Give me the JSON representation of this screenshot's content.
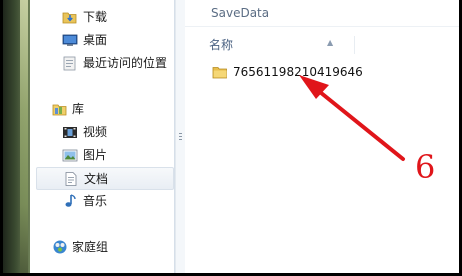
{
  "window": {
    "folder_title": "SaveData"
  },
  "sidebar": {
    "items": [
      {
        "label": "下载",
        "icon": "downloads-folder-icon"
      },
      {
        "label": "桌面",
        "icon": "desktop-icon"
      },
      {
        "label": "最近访问的位置",
        "icon": "recent-places-icon"
      },
      {
        "label": "库",
        "icon": "library-icon"
      },
      {
        "label": "视频",
        "icon": "videos-icon"
      },
      {
        "label": "图片",
        "icon": "pictures-icon"
      },
      {
        "label": "文档",
        "icon": "documents-icon"
      },
      {
        "label": "音乐",
        "icon": "music-icon"
      },
      {
        "label": "家庭组",
        "icon": "homegroup-icon"
      }
    ]
  },
  "content": {
    "column_name": "名称",
    "sort_glyph": "▲",
    "files": [
      {
        "name": "76561198210419646",
        "icon": "folder-icon"
      }
    ]
  },
  "annotation": {
    "number": "6",
    "color": "#e0151a"
  }
}
